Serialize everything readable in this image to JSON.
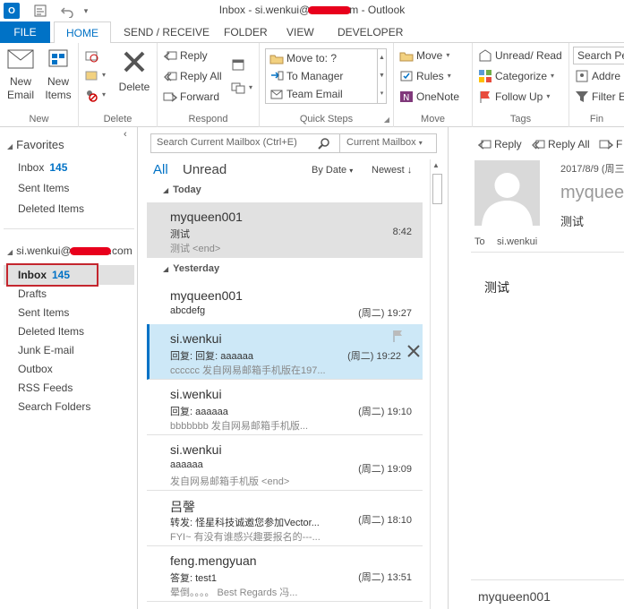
{
  "window": {
    "title_prefix": "Inbox - si.wenkui@",
    "title_suffix": "m - Outlook"
  },
  "tabs": [
    "FILE",
    "HOME",
    "SEND / RECEIVE",
    "FOLDER",
    "VIEW",
    "DEVELOPER"
  ],
  "ribbon": {
    "new": {
      "new_email": "New Email",
      "new_items": "New Items",
      "label": "New"
    },
    "delete": {
      "delete": "Delete",
      "label": "Delete"
    },
    "respond": {
      "reply": "Reply",
      "reply_all": "Reply All",
      "forward": "Forward",
      "label": "Respond"
    },
    "quick_steps": {
      "items": [
        "Move to: ?",
        "To Manager",
        "Team Email"
      ],
      "label": "Quick Steps"
    },
    "move": {
      "move": "Move",
      "rules": "Rules",
      "onenote": "OneNote",
      "label": "Move"
    },
    "tags": {
      "unread_read": "Unread/ Read",
      "categorize": "Categorize",
      "follow_up": "Follow Up",
      "label": "Tags"
    },
    "find": {
      "search_people": "Search Pe",
      "address_book": "Addre",
      "filter_email": "Filter E",
      "label": "Fin"
    }
  },
  "nav": {
    "favorites_label": "Favorites",
    "favorites": [
      {
        "label": "Inbox",
        "count": "145"
      },
      {
        "label": "Sent Items",
        "count": ""
      },
      {
        "label": "Deleted Items",
        "count": ""
      }
    ],
    "account_prefix": "si.wenkui@",
    "account_suffix": ".com",
    "folders": [
      {
        "label": "Inbox",
        "count": "145"
      },
      {
        "label": "Drafts",
        "count": ""
      },
      {
        "label": "Sent Items",
        "count": ""
      },
      {
        "label": "Deleted Items",
        "count": ""
      },
      {
        "label": "Junk E-mail",
        "count": ""
      },
      {
        "label": "Outbox",
        "count": ""
      },
      {
        "label": "RSS Feeds",
        "count": ""
      },
      {
        "label": "Search Folders",
        "count": ""
      }
    ]
  },
  "list": {
    "search_placeholder": "Search Current Mailbox (Ctrl+E)",
    "scope": "Current Mailbox",
    "filter_all": "All",
    "filter_unread": "Unread",
    "sort_by": "By Date",
    "sort_order": "Newest",
    "groups": [
      "Today",
      "Yesterday"
    ],
    "messages": [
      {
        "from": "myqueen001",
        "subject": "测试",
        "preview": "测试 <end>",
        "time": "8:42"
      },
      {
        "from": "myqueen001",
        "subject": "abcdefg",
        "preview": "",
        "time": "(周二) 19:27"
      },
      {
        "from": "si.wenkui",
        "subject": "回复: 回复: aaaaaa",
        "preview": "cccccc  发自网易邮箱手机版在197...",
        "time": "(周二) 19:22"
      },
      {
        "from": "si.wenkui",
        "subject": "回复: aaaaaa",
        "preview": "bbbbbbb  发自网易邮箱手机版...",
        "time": "(周二) 19:10"
      },
      {
        "from": "si.wenkui",
        "subject": "aaaaaa",
        "preview": "发自网易邮箱手机版 <end>",
        "time": "(周二) 19:09"
      },
      {
        "from": "吕謦",
        "subject": "转发: 怪星科技诚邀您参加Vector...",
        "preview": "FYI~  有没有谁感兴趣要报名的---...",
        "time": "(周二) 18:10"
      },
      {
        "from": "feng.mengyuan",
        "subject": "答复: test1",
        "preview": "晕倒。。。。  Best Regards  冯...",
        "time": "(周二) 13:51"
      }
    ]
  },
  "reading": {
    "reply": "Reply",
    "reply_all": "Reply All",
    "forward": "F",
    "date": "2017/8/9 (周三",
    "sender": "myqueen",
    "subject": "测试",
    "to_label": "To",
    "to": "si.wenkui",
    "body": "测试",
    "footer_sender": "myqueen001"
  },
  "colors": {
    "accent": "#0072c6",
    "selected_bg": "#e1e1e1",
    "hover_bg": "#cde8f7",
    "highlight_box": "#c4262e"
  }
}
